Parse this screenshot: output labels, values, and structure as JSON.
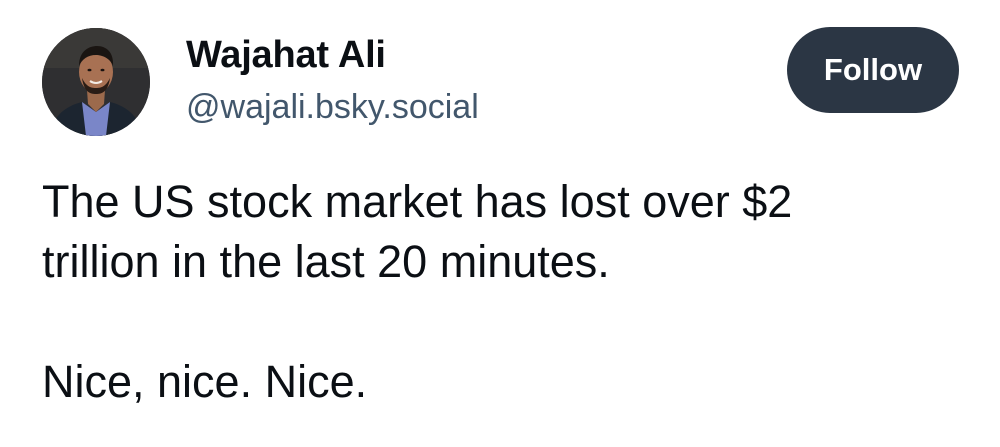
{
  "author": {
    "display_name": "Wajahat Ali",
    "handle": "@wajali.bsky.social"
  },
  "actions": {
    "follow_label": "Follow"
  },
  "post": {
    "line_1": "The US stock market has lost over $2",
    "line_2": "trillion in the last 20 minutes.",
    "line_3": "Nice, nice. Nice."
  },
  "colors": {
    "follow_button_bg": "#2b3644",
    "handle_text": "#42576c",
    "body_text": "#0b0f14"
  }
}
